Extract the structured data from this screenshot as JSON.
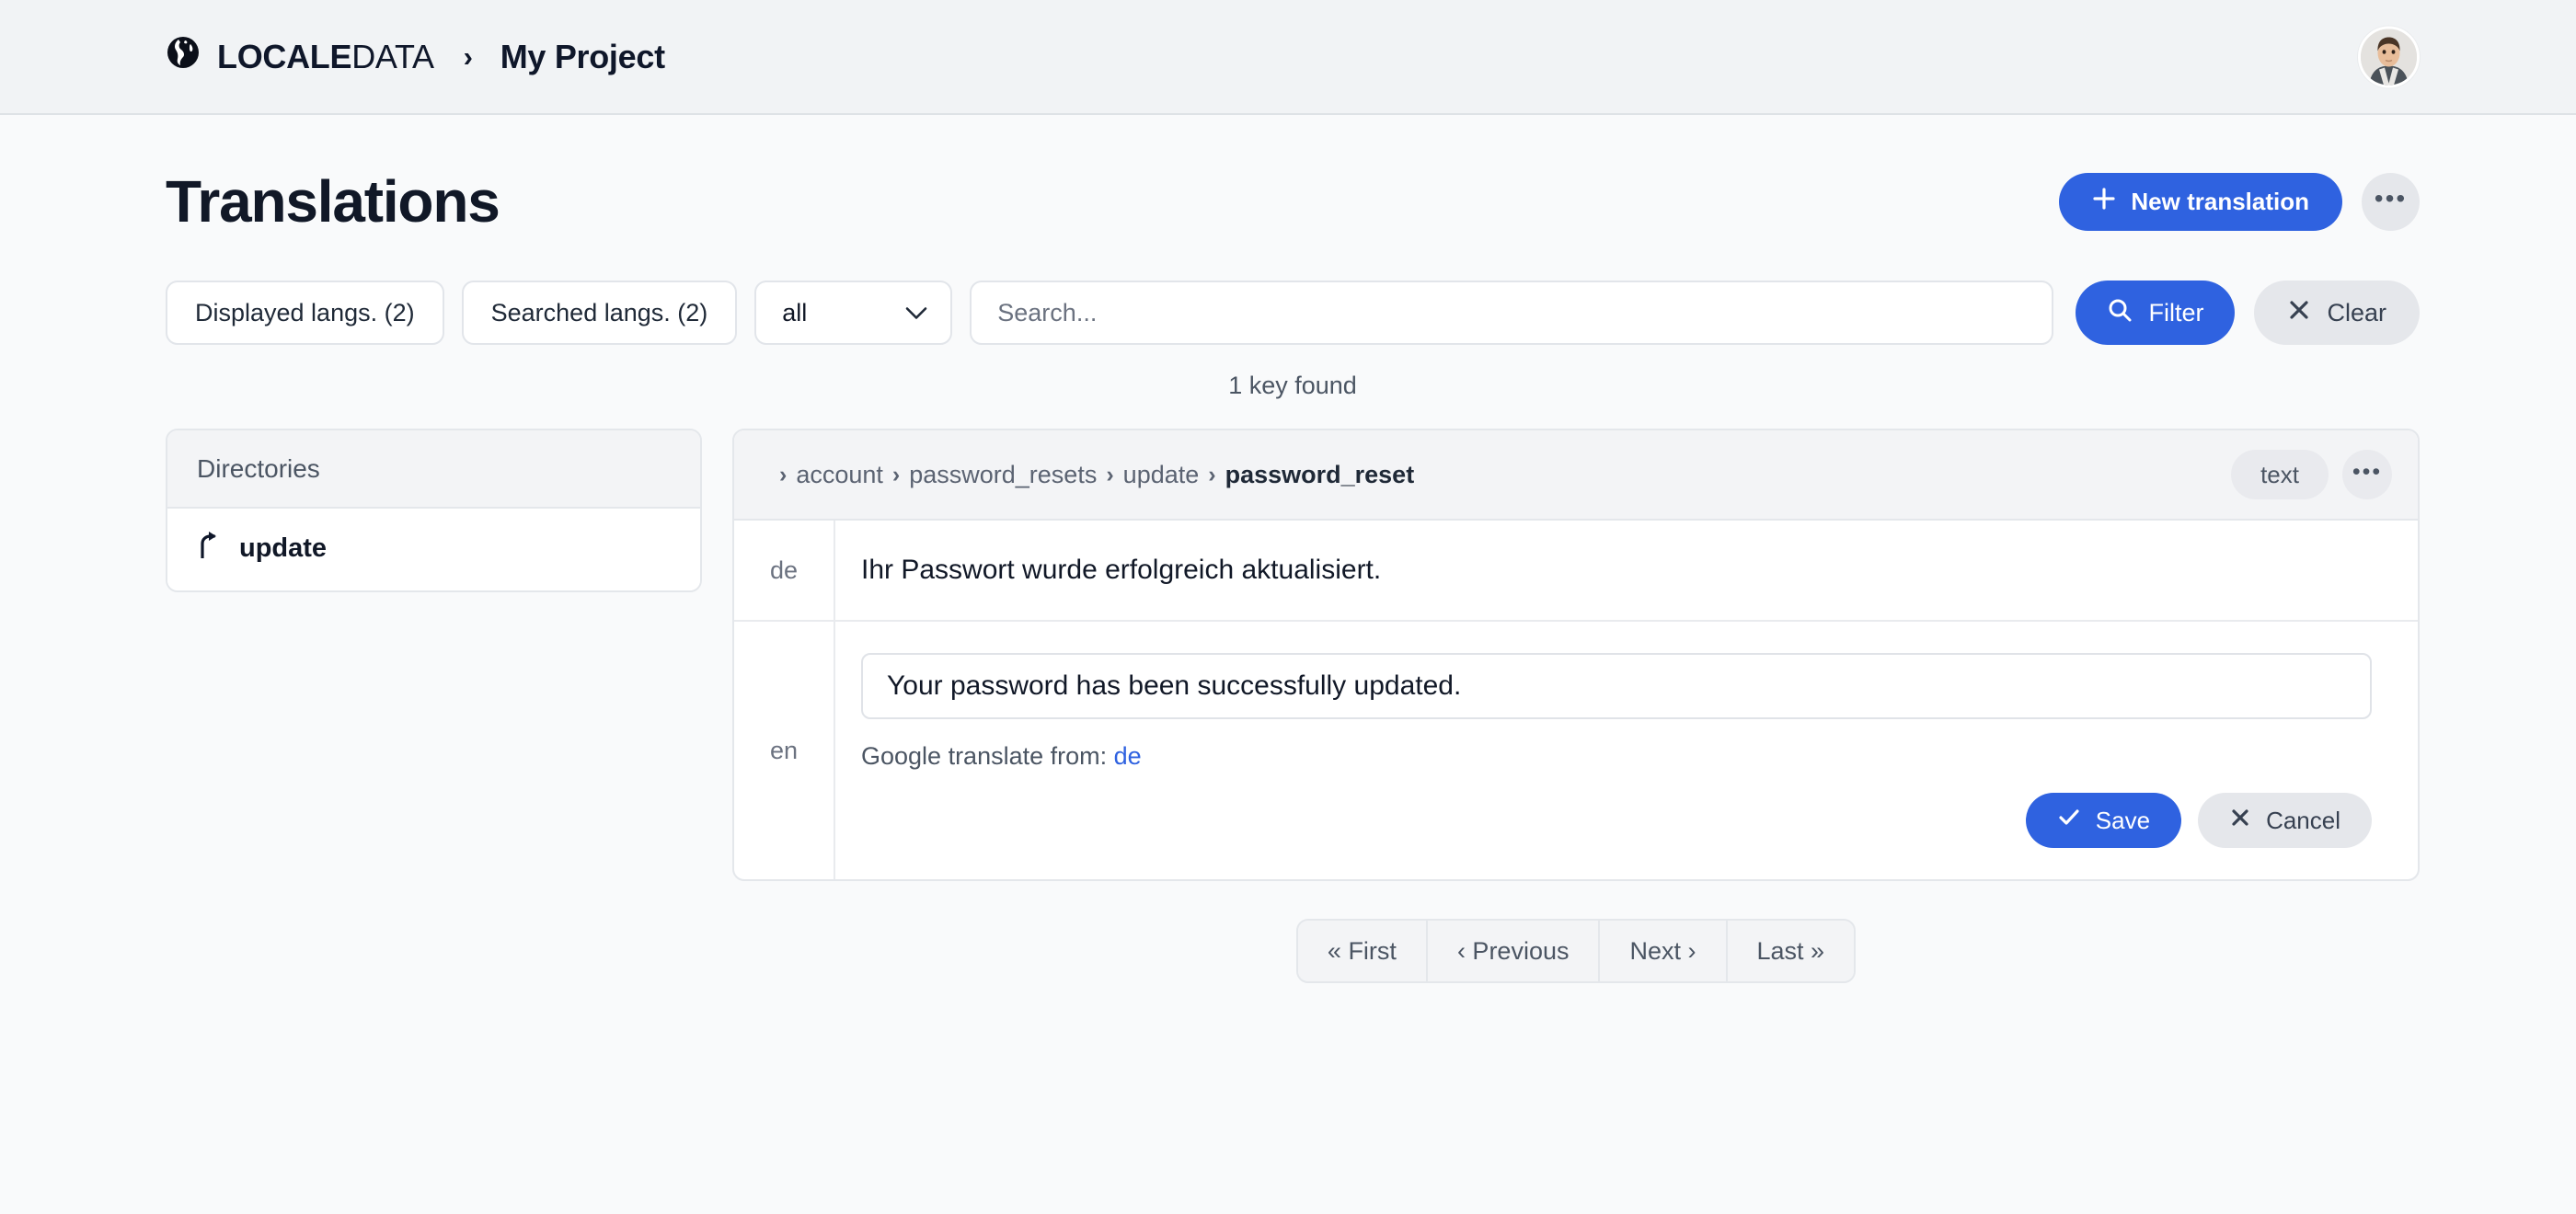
{
  "navbar": {
    "logo_icon": "globe-icon",
    "brand_strong": "LOCALE",
    "brand_light": "DATA",
    "separator": "›",
    "project": "My Project",
    "avatar_alt": "user-avatar"
  },
  "header": {
    "title": "Translations",
    "new_translation_label": "New translation",
    "new_translation_icon": "plus-icon",
    "more_menu_label": "•••"
  },
  "filters": {
    "displayed_langs_label": "Displayed langs. (2)",
    "searched_langs_label": "Searched langs. (2)",
    "scope_selected": "all",
    "scope_options": [
      "all"
    ],
    "search_value": "",
    "search_placeholder": "Search...",
    "filter_label": "Filter",
    "filter_icon": "search-icon",
    "clear_label": "Clear",
    "clear_icon": "close-icon",
    "results_text": "1 key found"
  },
  "directories": {
    "header": "Directories",
    "items": [
      {
        "label": "update",
        "icon": "arrow-up-level-icon"
      }
    ]
  },
  "translation_card": {
    "breadcrumb": {
      "separator": "›",
      "parts": [
        "account",
        "password_resets",
        "update"
      ],
      "current": "password_reset"
    },
    "type_chip": "text",
    "more_menu_label": "•••",
    "rows": [
      {
        "lang": "de",
        "mode": "static",
        "text": "Ihr Passwort wurde erfolgreich aktualisiert."
      },
      {
        "lang": "en",
        "mode": "edit",
        "value": "Your password has been successfully updated.",
        "hint_prefix": "Google translate from:",
        "hint_link": "de",
        "save_label": "Save",
        "save_icon": "check-icon",
        "cancel_label": "Cancel",
        "cancel_icon": "close-icon"
      }
    ]
  },
  "pagination": {
    "first": "« First",
    "previous": "‹ Previous",
    "next": "Next ›",
    "last": "Last »"
  },
  "colors": {
    "accent": "#2f62e0",
    "navbar_bg": "#f1f3f5",
    "page_bg": "#f9fafb",
    "muted_btn": "#e5e7eb",
    "link": "#2f62e0"
  }
}
